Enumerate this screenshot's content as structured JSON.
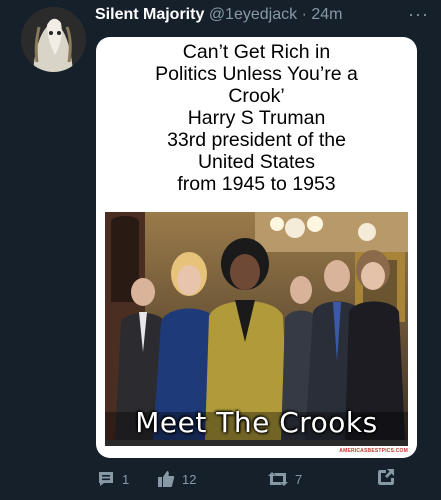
{
  "tweet": {
    "author_name": "Silent Majority",
    "handle": "@1eyedjack",
    "separator": "·",
    "time": "24m",
    "more": "···"
  },
  "meme": {
    "quote_lines": [
      "Can’t Get Rich in",
      "Politics Unless You’re a",
      "Crook’",
      "Harry S Truman",
      "33rd president of the",
      "United States",
      "from 1945 to 1953"
    ],
    "caption": "Meet The Crooks",
    "watermark": "AMERICASBESTPICS.COM"
  },
  "actions": {
    "reply_count": "1",
    "like_count": "12",
    "retweet_count": "7"
  },
  "colors": {
    "background": "#15202b",
    "muted": "#8899a6"
  },
  "icons": [
    "avatar-image",
    "more-icon",
    "reply-icon",
    "like-icon",
    "retweet-icon",
    "share-icon"
  ]
}
